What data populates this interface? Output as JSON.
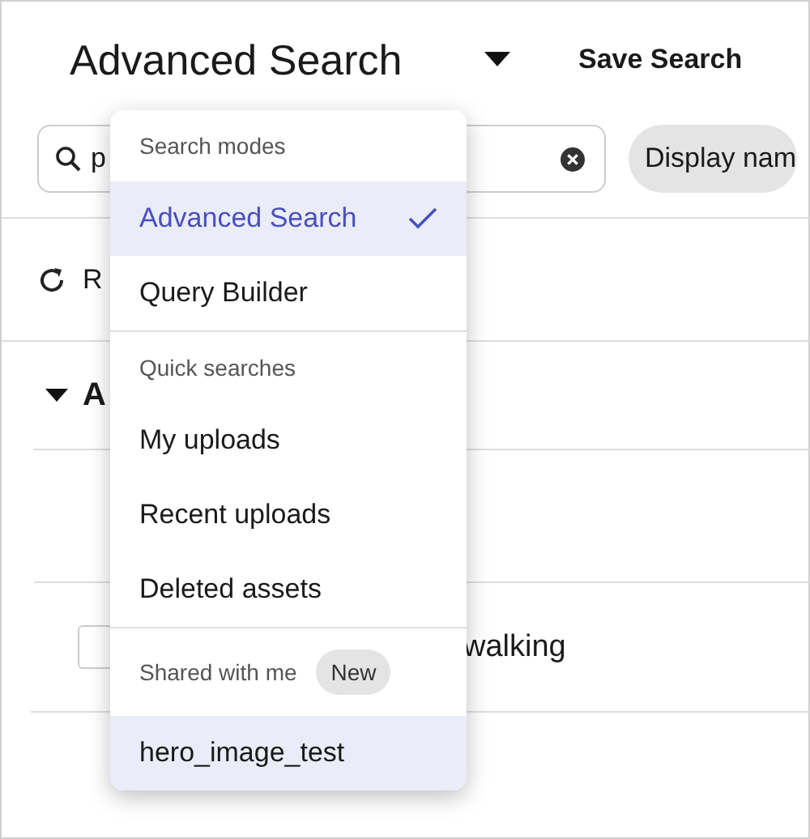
{
  "header": {
    "title": "Advanced Search",
    "save_button": "Save Search"
  },
  "search": {
    "value": "p",
    "filter_chip": "Display nam"
  },
  "toolbar": {
    "refresh_label": "R"
  },
  "group": {
    "label": "A",
    "expanded": true
  },
  "rows": [
    {
      "text": "walking",
      "checked": false
    }
  ],
  "menu": {
    "sections": [
      {
        "heading": "Search modes",
        "items": [
          {
            "label": "Advanced Search",
            "selected": true,
            "highlighted": true
          },
          {
            "label": "Query Builder",
            "selected": false,
            "highlighted": false
          }
        ]
      },
      {
        "heading": "Quick searches",
        "items": [
          {
            "label": "My uploads",
            "selected": false,
            "highlighted": false
          },
          {
            "label": "Recent uploads",
            "selected": false,
            "highlighted": false
          },
          {
            "label": "Deleted assets",
            "selected": false,
            "highlighted": false
          }
        ]
      },
      {
        "heading": "Shared with me",
        "badge": "New",
        "items": [
          {
            "label": "hero_image_test",
            "selected": false,
            "highlighted": true
          }
        ]
      }
    ]
  }
}
